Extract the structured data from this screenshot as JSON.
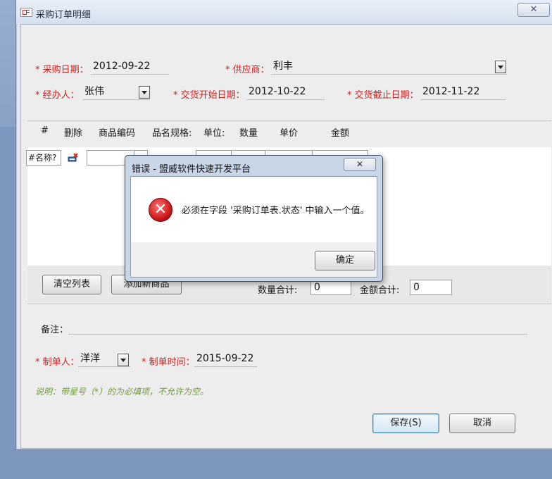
{
  "window": {
    "title": "采购订单明细",
    "close_glyph": "✕"
  },
  "form": {
    "purchase_date_label": "采购日期：",
    "purchase_date": "2012-09-22",
    "supplier_label": "供应商：",
    "supplier": "利丰",
    "handler_label": "经办人：",
    "handler": "张伟",
    "delivery_start_label": "交货开始日期：",
    "delivery_start": "2012-10-22",
    "delivery_end_label": "交货截止日期：",
    "delivery_end": "2012-11-22",
    "required_mark": "*"
  },
  "grid": {
    "columns": [
      "#",
      "删除",
      "商品编码",
      "品名规格:",
      "单位:",
      "数量",
      "单价",
      "金额"
    ],
    "row_name_cell": "#名称?"
  },
  "footer_bar": {
    "clear_list": "清空列表",
    "add_item_partial": "添加新商品",
    "qty_total_label": "数量合计:",
    "qty_total": "0",
    "amount_total_label": "金额合计:",
    "amount_total": "0"
  },
  "remarks": {
    "label": "备注：",
    "value": ""
  },
  "maker": {
    "maker_label": "制单人：",
    "maker": "洋洋",
    "time_label": "制单时间：",
    "time": "2015-09-22"
  },
  "note": "说明：带星号（*）的为必填项，不允许为空。",
  "buttons": {
    "save": "保存(S)",
    "cancel": "取消"
  },
  "dialog": {
    "title": "错误 - 盟威软件快速开发平台",
    "close_glyph": "✕",
    "error_glyph": "✕",
    "message": "必须在字段 '采购订单表.状态' 中输入一个值。",
    "ok": "确定"
  },
  "colors": {
    "required": "#d02020",
    "note": "#6f9a3a",
    "error": "#c10f0f"
  }
}
